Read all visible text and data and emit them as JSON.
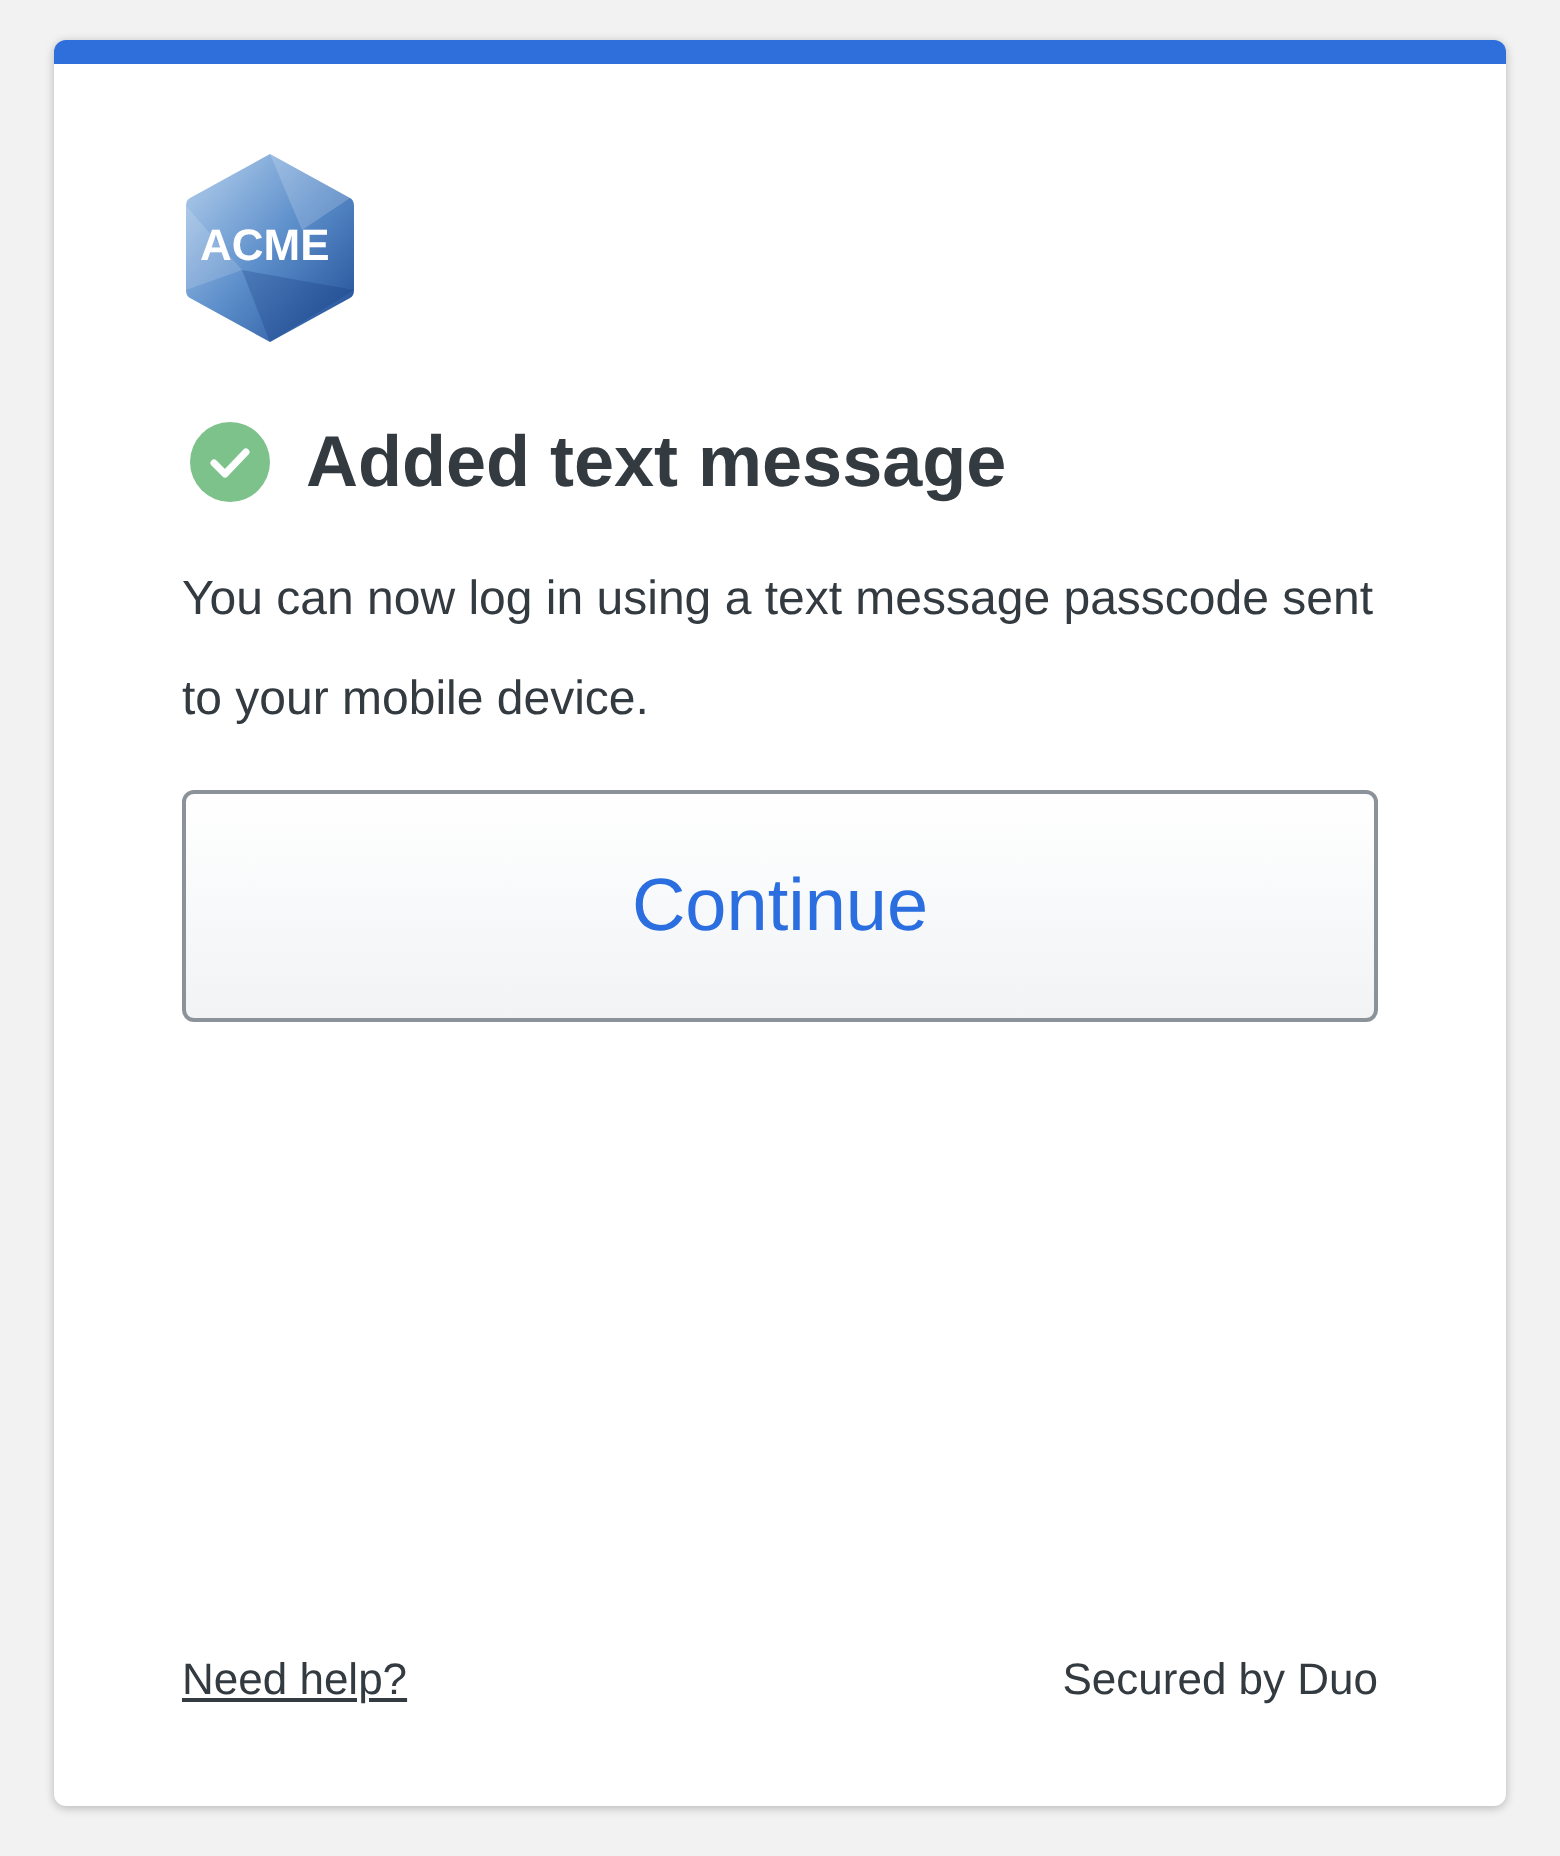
{
  "logo": {
    "text": "ACME"
  },
  "heading": {
    "kind": "success",
    "text": "Added text message"
  },
  "message": "You can now log in using a text message passcode sent to your mobile device.",
  "button": {
    "label": "Continue"
  },
  "footer": {
    "help_link": "Need help?",
    "secured_by": "Secured by Duo"
  }
}
